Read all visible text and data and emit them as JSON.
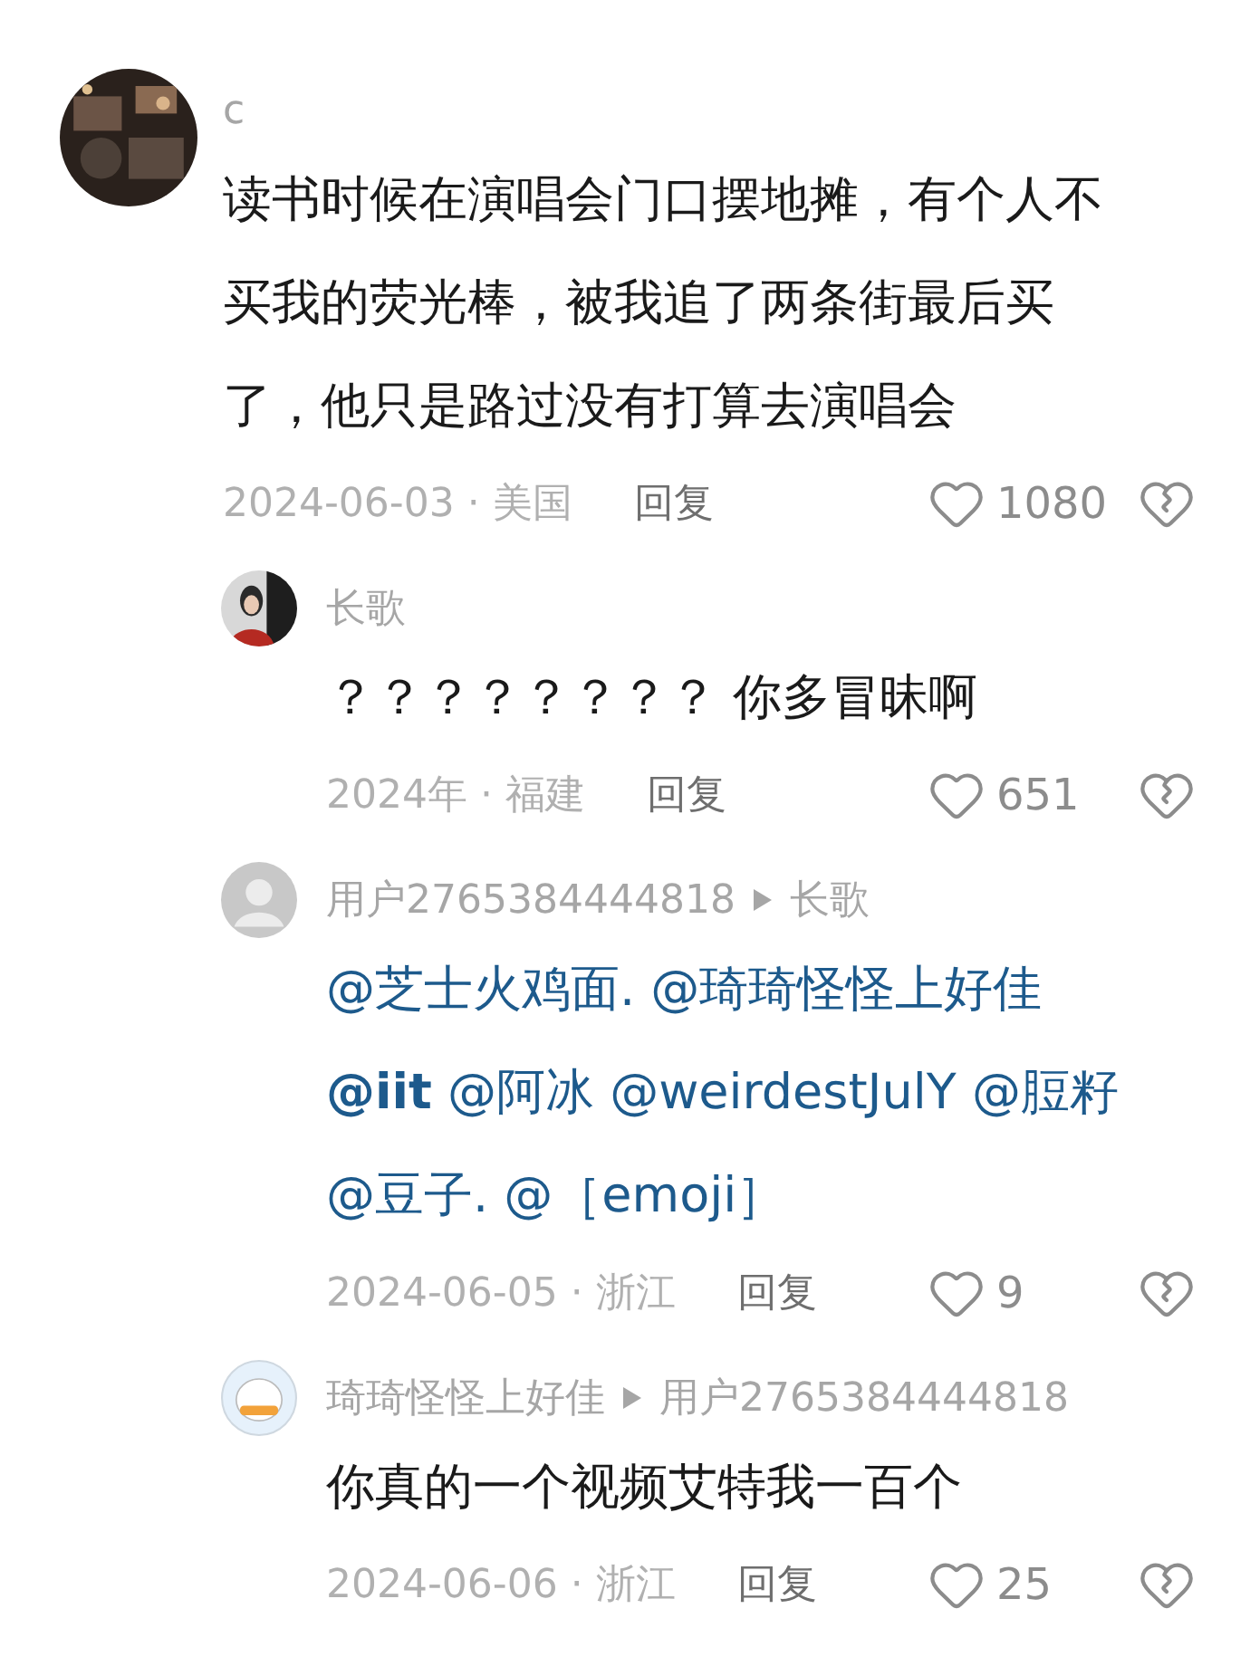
{
  "comments": [
    {
      "user": "c",
      "kind": "plain",
      "lines": [
        "读书时候在演唱会门口摆地摊，有个人不",
        "买我的荧光棒，被我追了两条街最后买",
        "了，他只是路过没有打算去演唱会"
      ],
      "meta": "2024-06-03 · 美国",
      "reply": "回复",
      "likes": "1080",
      "children": [
        {
          "user": "长歌",
          "kind": "plain",
          "lines": [
            "？？？？？？？？ 你多冒昧啊"
          ],
          "meta": "2024年 · 福建",
          "reply": "回复",
          "likes": "651"
        },
        {
          "user": "用户2765384444818",
          "reply_to": "长歌",
          "avatar": {
            "kind": "default"
          },
          "kind": "mention",
          "lines": [
            "@芝士火鸡面. @琦琦怪怪上好佳",
            "**@iit** @阿冰 @weirdestJulY @脰籽",
            "@豆子. @［emoji］"
          ],
          "meta": "2024-06-05 · 浙江",
          "reply": "回复",
          "likes": "9"
        },
        {
          "user": "琦琦怪怪上好佳",
          "reply_to": "用户2765384444818",
          "avatar": {
            "kind": "cartoon"
          },
          "kind": "plain",
          "lines": [
            "你真的一个视频艾特我一百个"
          ],
          "meta": "2024-06-06 · 浙江",
          "reply": "回复",
          "likes": "25"
        }
      ]
    }
  ]
}
